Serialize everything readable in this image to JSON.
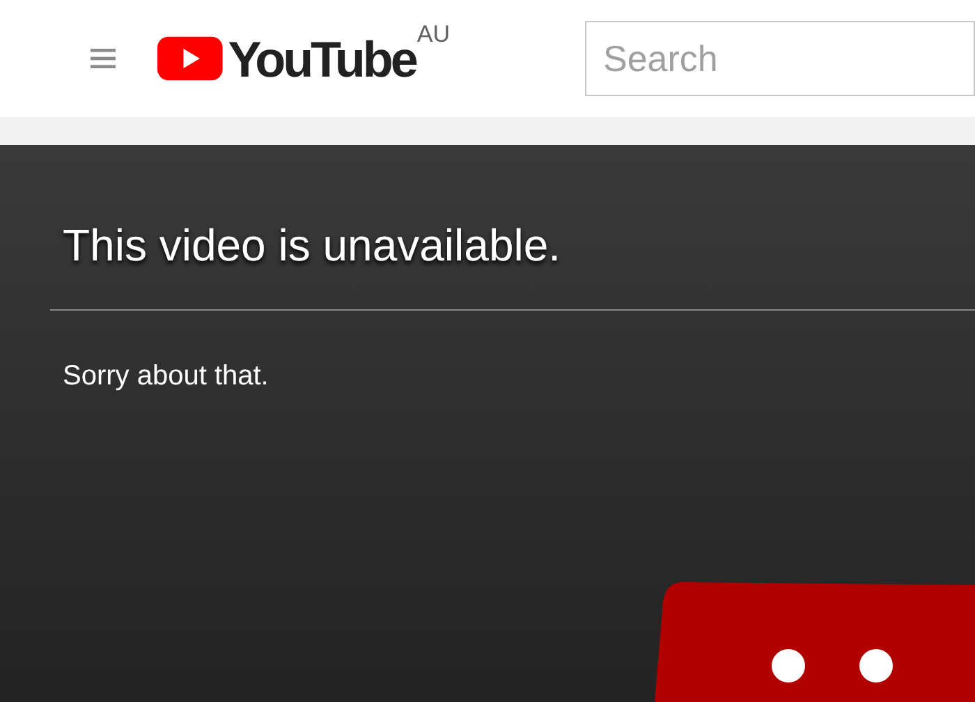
{
  "header": {
    "logo_text": "YouTube",
    "country": "AU",
    "search": {
      "placeholder": "Search"
    }
  },
  "message": {
    "title": "This video is unavailable.",
    "subtitle": "Sorry about that."
  }
}
